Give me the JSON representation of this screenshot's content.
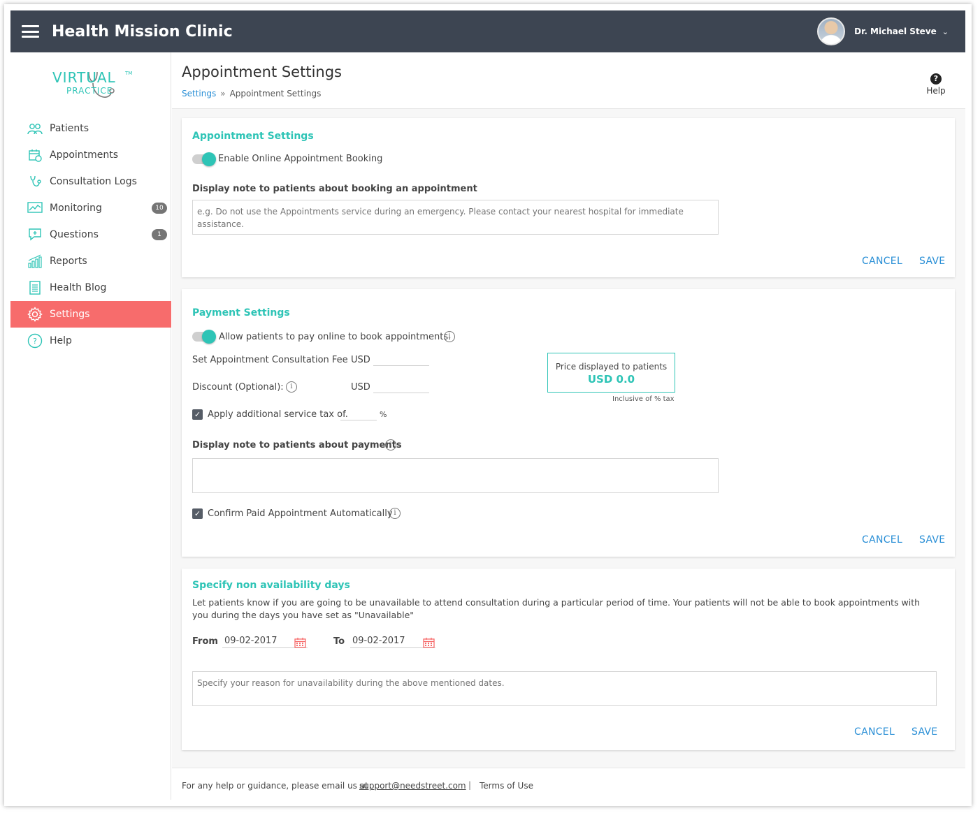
{
  "header": {
    "app_title": "Health Mission Clinic",
    "user_name": "Dr. Michael Steve"
  },
  "logo": {
    "line1": "VIRTUAL",
    "line2": "PRACTICE",
    "tm": "TM"
  },
  "sidebar": {
    "items": [
      {
        "label": "Patients",
        "icon": "patients-icon"
      },
      {
        "label": "Appointments",
        "icon": "calendar-icon"
      },
      {
        "label": "Consultation Logs",
        "icon": "stethoscope-icon"
      },
      {
        "label": "Monitoring",
        "icon": "chart-icon",
        "badge": "10"
      },
      {
        "label": "Questions",
        "icon": "question-chat-icon",
        "badge": "1"
      },
      {
        "label": "Reports",
        "icon": "bar-chart-icon"
      },
      {
        "label": "Health Blog",
        "icon": "document-icon"
      },
      {
        "label": "Settings",
        "icon": "gear-icon",
        "active": true
      },
      {
        "label": "Help",
        "icon": "help-circle-icon"
      }
    ]
  },
  "page": {
    "title": "Appointment Settings",
    "breadcrumb_root": "Settings",
    "breadcrumb_sep": "»",
    "breadcrumb_current": "Appointment Settings",
    "help_label": "Help",
    "help_glyph": "?"
  },
  "appointment_card": {
    "title": "Appointment Settings",
    "toggle_label": "Enable Online Appointment Booking",
    "note_label": "Display note to patients about booking an appointment",
    "note_placeholder": "e.g. Do not use the Appointments service during an emergency. Please contact your nearest hospital for immediate assistance.",
    "cancel": "CANCEL",
    "save": "SAVE"
  },
  "payment_card": {
    "title": "Payment Settings",
    "toggle_label": "Allow patients to pay online to book appointments.",
    "fee_label": "Set Appointment Consultation Fee",
    "fee_currency": "USD",
    "discount_label": "Discount (Optional):",
    "discount_currency": "USD",
    "tax_label": "Apply additional service tax of.",
    "tax_unit": "%",
    "price_label": "Price displayed to patients",
    "price_value": "USD 0.0",
    "price_note": "Inclusive of % tax",
    "note_label": "Display note to patients about payments",
    "confirm_label": "Confirm Paid Appointment Automatically",
    "cancel": "CANCEL",
    "save": "SAVE"
  },
  "availability_card": {
    "title": "Specify non availability days",
    "description": "Let patients know if you are going to be unavailable to attend consultation during a particular period of time. Your patients will not be able to book appointments with you during the days you have set as \"Unavailable\"",
    "from_label": "From",
    "from_value": "09-02-2017",
    "to_label": "To",
    "to_value": "09-02-2017",
    "reason_placeholder": "Specify your reason for unavailability during the above mentioned dates.",
    "cancel": "CANCEL",
    "save": "SAVE"
  },
  "footer": {
    "text": "For any help or guidance, please email us at",
    "email": "support@needstreet.com",
    "pipe": "|",
    "terms": "Terms of Use"
  },
  "colors": {
    "topbar": "#3d4552",
    "accent": "#2ec4b6",
    "active_nav": "#f76c6c",
    "link": "#2a8fd6"
  }
}
